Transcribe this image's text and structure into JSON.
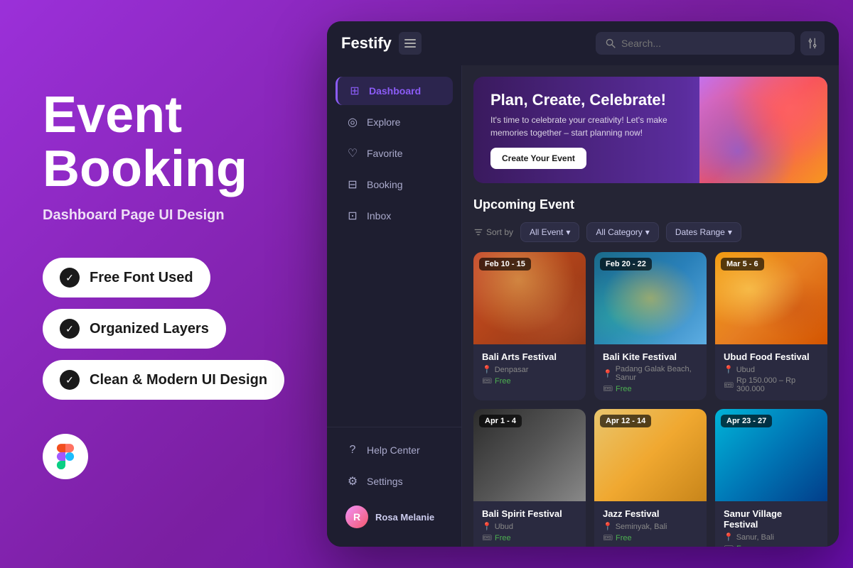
{
  "left": {
    "title_line1": "Event",
    "title_line2": "Booking",
    "subtitle": "Dashboard Page UI Design",
    "features": [
      {
        "id": "free-font",
        "label": "Free Font Used"
      },
      {
        "id": "organized-layers",
        "label": "Organized Layers"
      },
      {
        "id": "clean-ui",
        "label": "Clean & Modern UI Design"
      }
    ]
  },
  "dashboard": {
    "logo": "Festify",
    "search_placeholder": "Search...",
    "banner": {
      "title": "Plan, Create, Celebrate!",
      "description": "It's time to celebrate your creativity! Let's make memories together – start planning now!",
      "cta_label": "Create Your Event"
    },
    "nav": {
      "items": [
        {
          "id": "dashboard",
          "label": "Dashboard",
          "icon": "⊞",
          "active": true
        },
        {
          "id": "explore",
          "label": "Explore",
          "icon": "◎"
        },
        {
          "id": "favorite",
          "label": "Favorite",
          "icon": "♡"
        },
        {
          "id": "booking",
          "label": "Booking",
          "icon": "⊟"
        },
        {
          "id": "inbox",
          "label": "Inbox",
          "icon": "⊡"
        }
      ],
      "bottom_items": [
        {
          "id": "help",
          "label": "Help Center",
          "icon": "?"
        },
        {
          "id": "settings",
          "label": "Settings",
          "icon": "⚙"
        }
      ]
    },
    "user": {
      "name": "Rosa Melanie"
    },
    "section_title": "Upcoming Event",
    "filters": {
      "sort_label": "Sort by",
      "options": [
        "All Event",
        "All Category",
        "Dates Range"
      ]
    },
    "events": [
      {
        "id": 1,
        "date": "Feb 10 - 15",
        "name": "Bali Arts Festival",
        "location": "Denpasar",
        "price": "Free",
        "price_type": "free",
        "img_class": "card-img-1"
      },
      {
        "id": 2,
        "date": "Feb 20 - 22",
        "name": "Bali Kite Festival",
        "location": "Padang Galak Beach, Sanur",
        "price": "Free",
        "price_type": "free",
        "img_class": "card-img-2"
      },
      {
        "id": 3,
        "date": "Mar 5 - 6",
        "name": "Ubud Food Festival",
        "location": "Ubud",
        "price": "Rp 150.000 – Rp 300.000",
        "price_type": "paid",
        "img_class": "card-img-3"
      },
      {
        "id": 4,
        "date": "Apr 1 - 4",
        "name": "Bali Spirit Festival",
        "location": "Ubud",
        "price": "Free",
        "price_type": "free",
        "img_class": "card-img-4"
      },
      {
        "id": 5,
        "date": "Apr 12 - 14",
        "name": "Jazz Festival",
        "location": "Seminyak, Bali",
        "price": "Free",
        "price_type": "free",
        "img_class": "card-img-5"
      },
      {
        "id": 6,
        "date": "Apr 23 - 27",
        "name": "Sanur Village Festival",
        "location": "Sanur, Bali",
        "price": "Free",
        "price_type": "free",
        "img_class": "card-img-6"
      }
    ]
  }
}
